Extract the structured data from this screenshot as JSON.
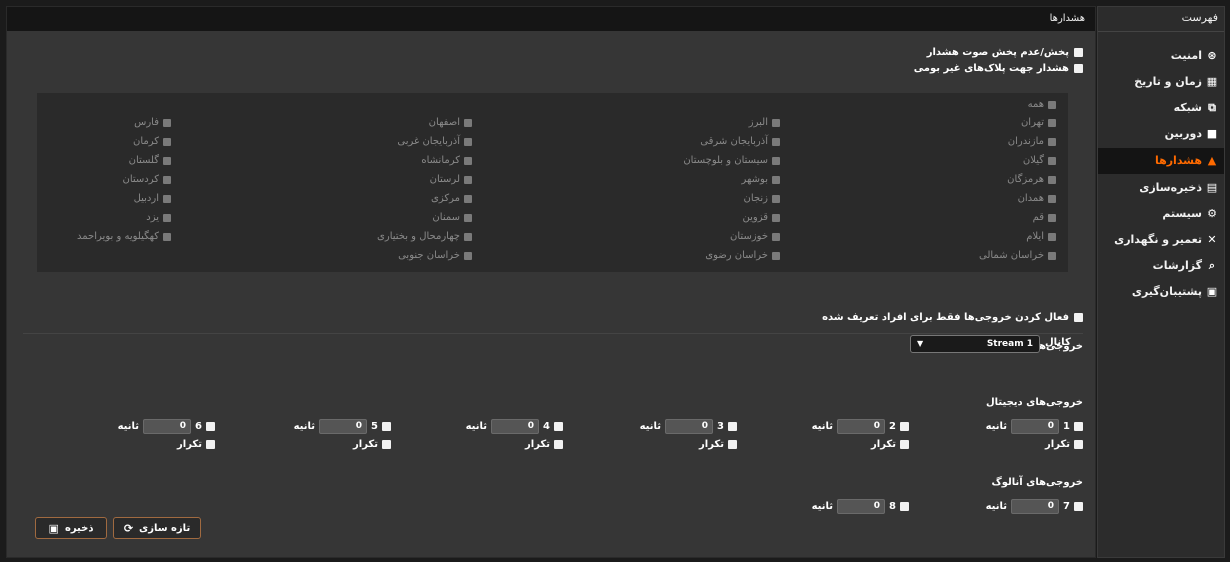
{
  "sidebar": {
    "title": "فهرست",
    "items": [
      {
        "label": "امنیت",
        "icon": "shield-icon",
        "glyph": "⊛"
      },
      {
        "label": "زمان و تاریخ",
        "icon": "calendar-icon",
        "glyph": "▦"
      },
      {
        "label": "شبکه",
        "icon": "network-icon",
        "glyph": "⧉"
      },
      {
        "label": "دوربین",
        "icon": "camera-icon",
        "glyph": "■"
      },
      {
        "label": "هشدارها",
        "icon": "bell-icon",
        "glyph": "▲"
      },
      {
        "label": "ذخیره‌سازی",
        "icon": "storage-icon",
        "glyph": "▤"
      },
      {
        "label": "سیستم",
        "icon": "gears-icon",
        "glyph": "⚙"
      },
      {
        "label": "تعمیر و نگهداری",
        "icon": "tools-icon",
        "glyph": "✕"
      },
      {
        "label": "گزارشات",
        "icon": "report-search-icon",
        "glyph": "⌕"
      },
      {
        "label": "پشتیبان‌گیری",
        "icon": "backup-icon",
        "glyph": "▣"
      }
    ],
    "active_index": 4
  },
  "main": {
    "title": "هشدارها",
    "options": {
      "sound_toggle": "پخش/عدم پخش صوت هشدار",
      "foreign_plates": "هشدار جهت پلاک‌های غیر بومی"
    },
    "provinces_all": "همه",
    "provinces": [
      [
        "تهران",
        "البرز",
        "اصفهان",
        "فارس"
      ],
      [
        "مازندران",
        "آذربایجان شرقی",
        "آذربایجان غربی",
        "کرمان"
      ],
      [
        "گیلان",
        "سیستان و بلوچستان",
        "کرمانشاه",
        "گلستان"
      ],
      [
        "هرمزگان",
        "بوشهر",
        "لرستان",
        "کردستان"
      ],
      [
        "همدان",
        "زنجان",
        "مرکزی",
        "اردبیل"
      ],
      [
        "قم",
        "قزوین",
        "سمنان",
        "یزد"
      ],
      [
        "ایلام",
        "خوزستان",
        "چهارمحال و بختیاری",
        "کهگیلویه و بویراحمد"
      ],
      [
        "خراسان شمالی",
        "خراسان رضوی",
        "خراسان جنوبی",
        ""
      ]
    ],
    "defined_only": "فعال کردن خروجی‌ها فقط برای افراد تعریف شده",
    "outputs_title": "خروجی‌ها",
    "channel_label": "کانال",
    "channel_value": "Stream 1",
    "digital_title": "خروجی‌های دیجیتال",
    "analog_title": "خروجی‌های آنالوگ",
    "seconds_label": "ثانیه",
    "repeat_label": "تکرار",
    "digital_outputs": [
      {
        "num": "1",
        "value": "0"
      },
      {
        "num": "2",
        "value": "0"
      },
      {
        "num": "3",
        "value": "0"
      },
      {
        "num": "4",
        "value": "0"
      },
      {
        "num": "5",
        "value": "0"
      },
      {
        "num": "6",
        "value": "0"
      }
    ],
    "analog_outputs": [
      {
        "num": "7",
        "value": "0"
      },
      {
        "num": "8",
        "value": "0"
      }
    ],
    "refresh_label": "تازه سازی",
    "save_label": "ذخیره"
  }
}
